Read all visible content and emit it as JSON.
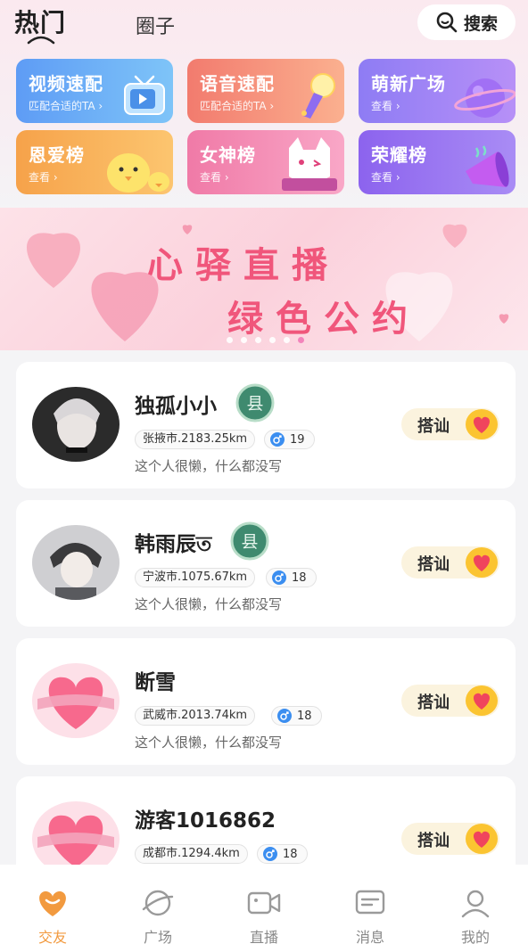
{
  "header": {
    "tabs": [
      "热门",
      "圈子"
    ],
    "search_label": "搜索"
  },
  "features": [
    {
      "title": "视频速配",
      "sub": "匹配合适的TA ›"
    },
    {
      "title": "语音速配",
      "sub": "匹配合适的TA ›"
    },
    {
      "title": "萌新广场",
      "sub": "查看 ›"
    },
    {
      "title": "恩爱榜",
      "sub": "查看 ›"
    },
    {
      "title": "女神榜",
      "sub": "查看 ›"
    },
    {
      "title": "荣耀榜",
      "sub": "查看 ›"
    }
  ],
  "banner": {
    "line1": "心驿直播",
    "line2": "绿色公约"
  },
  "users": [
    {
      "name": "独孤小小",
      "location": "张掖市.2183.25km",
      "age": "19",
      "bio": "这个人很懒，什么都没写",
      "level": "县"
    },
    {
      "name": "韩雨辰ত",
      "location": "宁波市.1075.67km",
      "age": "18",
      "bio": "这个人很懒，什么都没写",
      "level": "县"
    },
    {
      "name": "断雪",
      "location": "武威市.2013.74km",
      "age": "18",
      "bio": "这个人很懒，什么都没写",
      "level": ""
    },
    {
      "name": "游客1016862",
      "location": "成都市.1294.4km",
      "age": "18",
      "bio": "",
      "level": ""
    }
  ],
  "chat_label": "搭讪",
  "nav": [
    "交友",
    "广场",
    "直播",
    "消息",
    "我的"
  ],
  "colors": {
    "accent": "#f29a3f",
    "banner_text": "#f0567b",
    "gender_male": "#3b8ef0"
  }
}
